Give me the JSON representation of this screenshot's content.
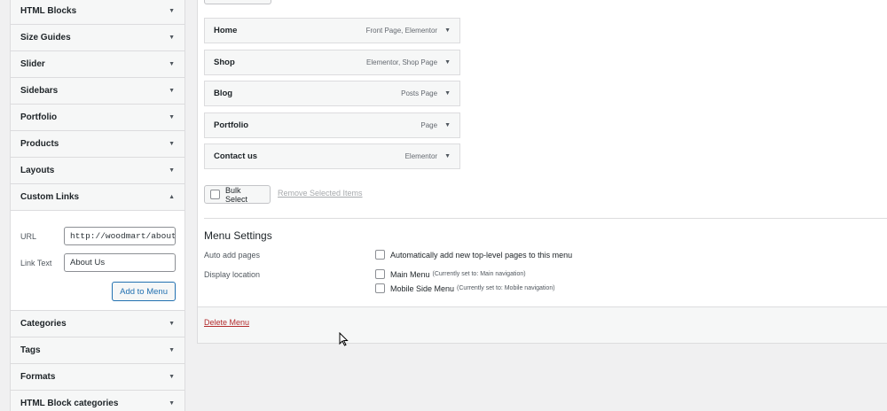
{
  "accordion_top": [
    {
      "label": "HTML Blocks"
    },
    {
      "label": "Size Guides"
    },
    {
      "label": "Slider"
    },
    {
      "label": "Sidebars"
    },
    {
      "label": "Portfolio"
    },
    {
      "label": "Products"
    },
    {
      "label": "Layouts"
    }
  ],
  "custom_links": {
    "label": "Custom Links",
    "url_label": "URL",
    "url_value": "http://woodmart/about",
    "link_text_label": "Link Text",
    "link_text_value": "About Us",
    "add_button": "Add to Menu"
  },
  "accordion_bottom": [
    {
      "label": "Categories"
    },
    {
      "label": "Tags"
    },
    {
      "label": "Formats"
    },
    {
      "label": "HTML Block categories"
    }
  ],
  "menu_items": [
    {
      "label": "Home",
      "type": "Front Page, Elementor"
    },
    {
      "label": "Shop",
      "type": "Elementor, Shop Page"
    },
    {
      "label": "Blog",
      "type": "Posts Page"
    },
    {
      "label": "Portfolio",
      "type": "Page"
    },
    {
      "label": "Contact us",
      "type": "Elementor"
    }
  ],
  "bulk_select": "Bulk Select",
  "remove_selected": "Remove Selected Items",
  "settings": {
    "title": "Menu Settings",
    "auto_add_label": "Auto add pages",
    "auto_add_option": "Automatically add new top-level pages to this menu",
    "display_location_label": "Display location",
    "main_menu": "Main Menu",
    "main_menu_note": "(Currently set to: Main navigation)",
    "mobile_menu": "Mobile Side Menu",
    "mobile_menu_note": "(Currently set to: Mobile navigation)"
  },
  "delete_menu": "Delete Menu"
}
